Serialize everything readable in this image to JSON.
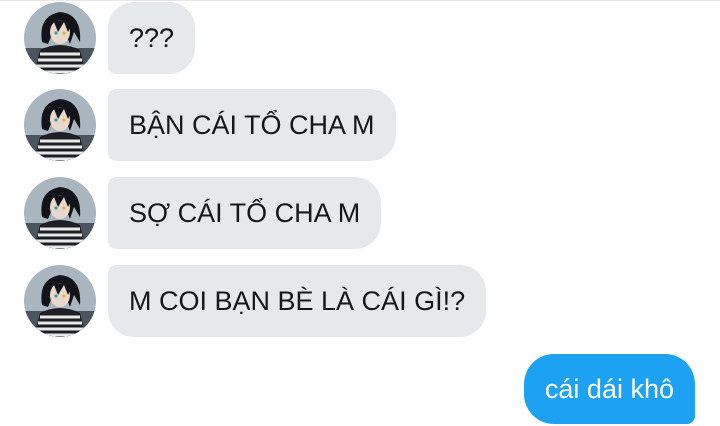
{
  "conversation": {
    "incoming": [
      {
        "text": "???",
        "avatar_icon": "user-avatar-icon"
      },
      {
        "text": "BẬN CÁI TỔ CHA M",
        "avatar_icon": "user-avatar-icon"
      },
      {
        "text": "SỢ CÁI TỔ CHA M",
        "avatar_icon": "user-avatar-icon"
      },
      {
        "text": "M COI BẠN BÈ LÀ CÁI GÌ!?",
        "avatar_icon": "user-avatar-icon"
      }
    ],
    "outgoing": [
      {
        "text": "cái dái khô"
      }
    ]
  },
  "colors": {
    "incoming_bubble": "#e5e9ec",
    "outgoing_bubble": "#1da1f2",
    "incoming_text": "#14171a",
    "outgoing_text": "#ffffff"
  }
}
